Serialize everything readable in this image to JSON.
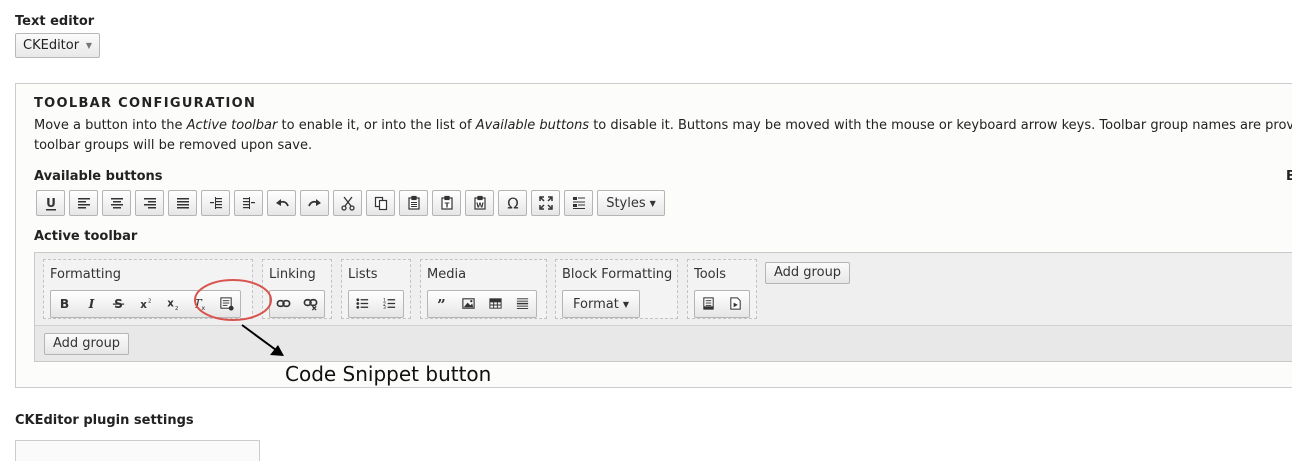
{
  "text_editor": {
    "label": "Text editor",
    "selected": "CKEditor"
  },
  "toolbar_config": {
    "title": "TOOLBAR CONFIGURATION",
    "description": {
      "part1": "Move a button into the ",
      "em1": "Active toolbar",
      "part2": " to enable it, or into the list of ",
      "em2": "Available buttons",
      "part3": " to disable it. Buttons may be moved with the mouse or keyboard arrow keys. Toolbar group names are prov",
      "line2": "toolbar groups will be removed upon save."
    },
    "available_label": "Available buttons",
    "right_cut_label": "B",
    "available_buttons": [
      {
        "icon": "underline-icon"
      },
      {
        "icon": "align-left-icon"
      },
      {
        "icon": "align-center-icon"
      },
      {
        "icon": "align-right-icon"
      },
      {
        "icon": "justify-icon"
      },
      {
        "icon": "outdent-icon"
      },
      {
        "icon": "indent-icon"
      },
      {
        "icon": "undo-icon"
      },
      {
        "icon": "redo-icon"
      },
      {
        "icon": "cut-icon"
      },
      {
        "icon": "copy-icon"
      },
      {
        "icon": "paste-icon"
      },
      {
        "icon": "paste-text-icon"
      },
      {
        "icon": "paste-word-icon"
      },
      {
        "icon": "special-char-icon"
      },
      {
        "icon": "maximize-icon"
      },
      {
        "icon": "show-blocks-icon"
      }
    ],
    "styles_label": "Styles",
    "active_label": "Active toolbar",
    "groups": {
      "formatting": "Formatting",
      "linking": "Linking",
      "lists": "Lists",
      "media": "Media",
      "block_formatting": "Block Formatting",
      "tools": "Tools"
    },
    "format_label": "Format",
    "add_group": "Add group"
  },
  "annotation": {
    "text": "Code Snippet button",
    "color": "#d9534f"
  },
  "plugin_settings_label": "CKEditor plugin settings"
}
